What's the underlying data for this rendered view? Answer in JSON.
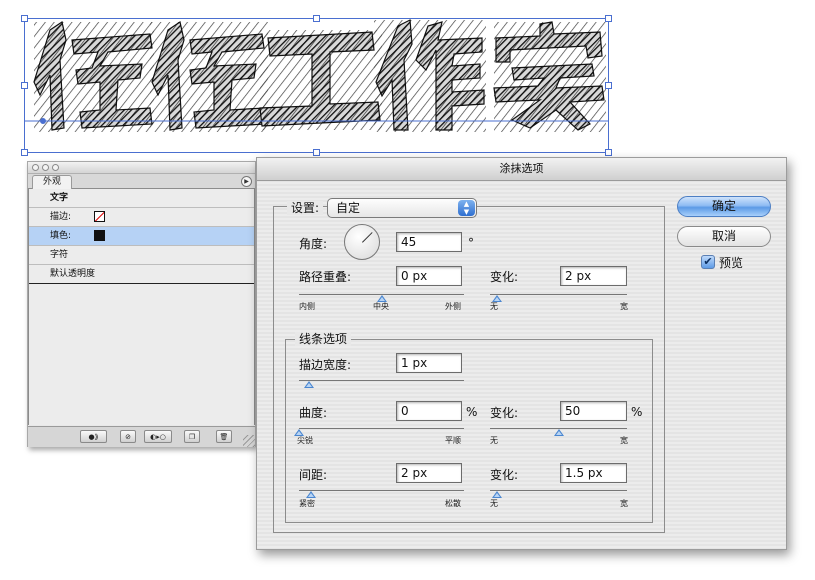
{
  "artwork": {
    "scribble_text": "佐佐工作室",
    "accent_color": "#4a6fd0"
  },
  "appearance_panel": {
    "tab": "外观",
    "rows": [
      {
        "label": "文字",
        "swatch": "none"
      },
      {
        "label": "描边:",
        "swatch": "stroke-none"
      },
      {
        "label": "填色:",
        "swatch": "fill-black"
      },
      {
        "label": "字符",
        "swatch": "none"
      },
      {
        "label": "默认透明度",
        "swatch": "none"
      }
    ],
    "footer_icons": [
      "new-effect-icon",
      "clear-appearance-icon",
      "reduce-basic-icon",
      "duplicate-item-icon",
      "delete-item-icon"
    ]
  },
  "dialog": {
    "title": "涂抹选项",
    "settings_label": "设置:",
    "settings_value": "自定",
    "angle_label": "角度:",
    "angle_value": "45",
    "angle_unit": "°",
    "path_overlap_label": "路径重叠:",
    "path_overlap_value": "0 px",
    "path_overlap_ticks": [
      "内侧",
      "中央",
      "外侧"
    ],
    "overlap_variation_label": "变化:",
    "overlap_variation_value": "2 px",
    "overlap_variation_ticks": [
      "无",
      "宽"
    ],
    "line_options_title": "线条选项",
    "stroke_width_label": "描边宽度:",
    "stroke_width_value": "1 px",
    "curviness_label": "曲度:",
    "curviness_value": "0",
    "curviness_unit": "%",
    "curviness_ticks": [
      "尖锐",
      "平顺"
    ],
    "curviness_variation_label": "变化:",
    "curviness_variation_value": "50",
    "curviness_variation_unit": "%",
    "curviness_variation_ticks": [
      "无",
      "宽"
    ],
    "spacing_label": "间距:",
    "spacing_value": "2 px",
    "spacing_ticks": [
      "紧密",
      "松散"
    ],
    "spacing_variation_label": "变化:",
    "spacing_variation_value": "1.5 px",
    "spacing_variation_ticks": [
      "无",
      "宽"
    ],
    "ok_label": "确定",
    "cancel_label": "取消",
    "preview_label": "预览",
    "preview_checked": true,
    "slider_levels": {
      "path_overlap_fraction": 0.5,
      "overlap_variation_fraction": 0.05,
      "stroke_width_fraction": 0.06,
      "curviness_fraction": 0.0,
      "curviness_variation_fraction": 0.5,
      "spacing_fraction": 0.07,
      "spacing_variation_fraction": 0.05
    }
  }
}
